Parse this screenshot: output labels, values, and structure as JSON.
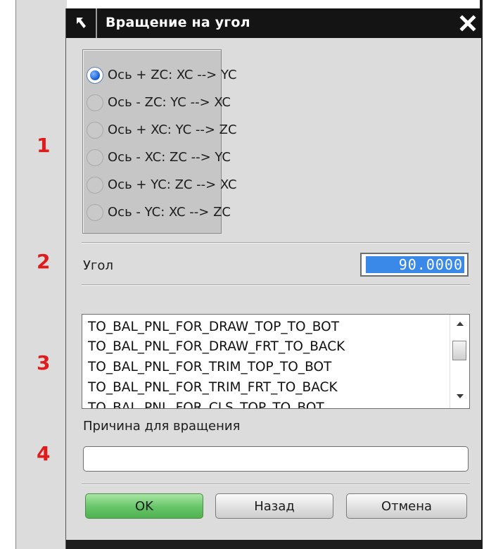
{
  "window": {
    "title": "Вращение на угол"
  },
  "steps": [
    "1",
    "2",
    "3",
    "4"
  ],
  "rotation_options": [
    {
      "label": "Ось + ZC:  XC --> YC",
      "checked": true
    },
    {
      "label": "Ось - ZC:  YC --> XC",
      "checked": false
    },
    {
      "label": "Ось + XC:  YC --> ZC",
      "checked": false
    },
    {
      "label": "Ось - XC:  ZC --> YC",
      "checked": false
    },
    {
      "label": "Ось + YC:  ZC --> XC",
      "checked": false
    },
    {
      "label": "Ось - YC:  XC --> ZC",
      "checked": false
    }
  ],
  "angle": {
    "label": "Угол",
    "value": "90.0000"
  },
  "reasons_list": [
    "TO_BAL_PNL_FOR_DRAW_TOP_TO_BOT",
    "TO_BAL_PNL_FOR_DRAW_FRT_TO_BACK",
    "TO_BAL_PNL_FOR_TRIM_TOP_TO_BOT",
    "TO_BAL_PNL_FOR_TRIM_FRT_TO_BACK",
    "TO_BAL_PNL_FOR_CLS_TOP_TO_BOT"
  ],
  "reason": {
    "label": "Причина для вращения",
    "value": ""
  },
  "buttons": {
    "ok": "OK",
    "back": "Назад",
    "cancel": "Отмена"
  },
  "colors": {
    "accent_selection": "#3a88e8",
    "ok_button": "#66c468",
    "step_numbers": "#e01b1b",
    "titlebar": "#141414"
  }
}
